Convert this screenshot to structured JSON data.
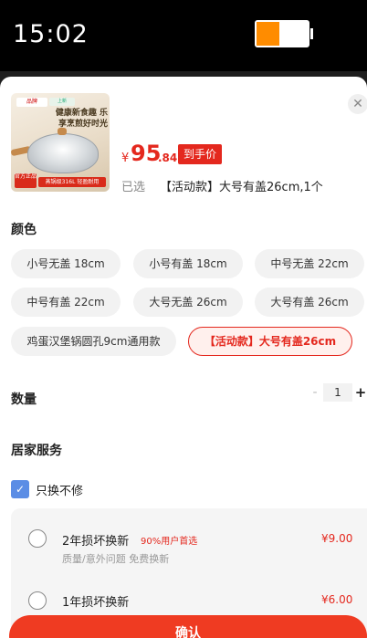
{
  "status_bar": {
    "time": "15:02",
    "battery_level": 0.45
  },
  "product": {
    "image": {
      "brand": "品牌",
      "tag": "上新",
      "headline": "健康新食趣 乐享烹煎好时光",
      "badge": "官方正品",
      "bottom_text": "蒸锅级316L 轻盈耐用"
    },
    "price_symbol": "¥",
    "price_integer": "95",
    "price_decimal": ".84",
    "price_tag": "到手价",
    "selected_label": "已选",
    "selected_value": "【活动款】大号有盖26cm,1个"
  },
  "color_section": {
    "title": "颜色",
    "options": [
      "小号无盖 18cm",
      "小号有盖 18cm",
      "中号无盖 22cm",
      "中号有盖 22cm",
      "大号无盖 26cm",
      "大号有盖 26cm",
      "鸡蛋汉堡锅圆孔9cm通用款",
      "【活动款】大号有盖26cm"
    ],
    "selected": "【活动款】大号有盖26cm"
  },
  "quantity": {
    "label": "数量",
    "value": "1",
    "minus": "-",
    "plus": "+"
  },
  "home_service": {
    "title": "居家服务",
    "option_label": "只换不修",
    "plans": [
      {
        "name": "2年损坏换新",
        "hint": "90%用户首选",
        "desc": "质量/意外问题 免费换新",
        "price": "¥9.00"
      },
      {
        "name": "1年损坏换新",
        "hint": "",
        "desc": "",
        "price": "¥6.00"
      }
    ]
  },
  "confirm_label": "确认",
  "colors": {
    "accent": "#e4281e",
    "button": "#ef3b22",
    "chip_bg": "#f2f2f2",
    "battery": "#ff8c00"
  },
  "icons": {
    "close": "close-icon",
    "shield": "shield-check-icon"
  }
}
